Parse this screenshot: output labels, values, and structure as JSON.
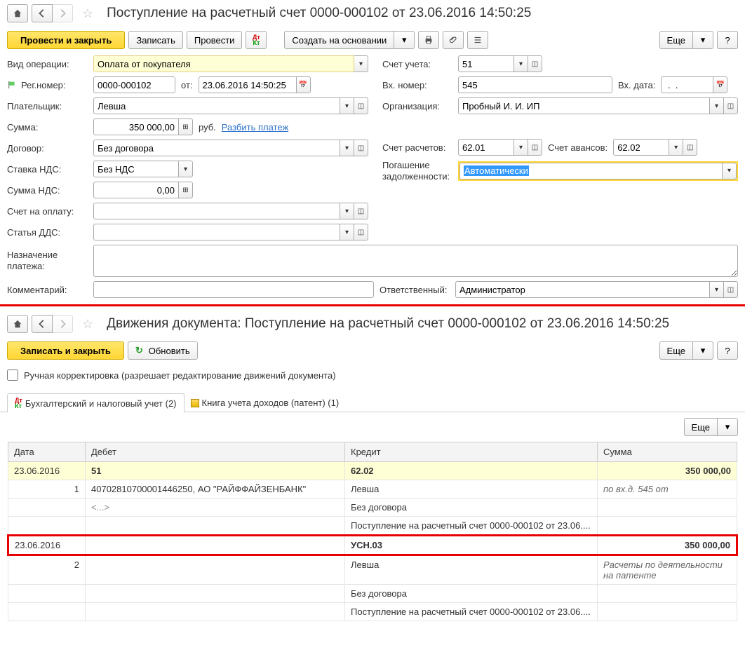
{
  "section1": {
    "title": "Поступление на расчетный счет 0000-000102 от 23.06.2016 14:50:25",
    "buttons": {
      "post_close": "Провести и закрыть",
      "save": "Записать",
      "post": "Провести",
      "create_based": "Создать на основании",
      "more": "Еще"
    },
    "labels": {
      "op_type": "Вид операции:",
      "reg_num": "Рег.номер:",
      "from": "от:",
      "payer": "Плательщик:",
      "sum": "Сумма:",
      "currency": "руб.",
      "split": "Разбить платеж",
      "contract": "Договор:",
      "vat_rate": "Ставка НДС:",
      "vat_sum": "Сумма НДС:",
      "invoice": "Счет на оплату:",
      "dds": "Статья ДДС:",
      "purpose": "Назначение платежа:",
      "comment": "Комментарий:",
      "account": "Счет учета:",
      "in_num": "Вх. номер:",
      "in_date": "Вх. дата:",
      "org": "Организация:",
      "settlement_acc": "Счет расчетов:",
      "advance_acc": "Счет авансов:",
      "debt_repay": "Погашение задолженности:",
      "responsible": "Ответственный:"
    },
    "values": {
      "op_type": "Оплата от покупателя",
      "reg_num": "0000-000102",
      "date": "23.06.2016 14:50:25",
      "payer": "Левша",
      "sum": "350 000,00",
      "contract": "Без договора",
      "vat_rate": "Без НДС",
      "vat_sum": "0,00",
      "invoice": "",
      "dds": "",
      "purpose": "",
      "comment": "",
      "account": "51",
      "in_num": "545",
      "in_date": " .  .",
      "org": "Пробный И. И. ИП",
      "settlement_acc": "62.01",
      "advance_acc": "62.02",
      "debt_repay": "Автоматически",
      "responsible": "Администратор"
    }
  },
  "section2": {
    "title": "Движения документа: Поступление на расчетный счет 0000-000102 от 23.06.2016 14:50:25",
    "buttons": {
      "save_close": "Записать и закрыть",
      "refresh": "Обновить",
      "more": "Еще"
    },
    "manual_correction": "Ручная корректировка (разрешает редактирование движений документа)",
    "tabs": {
      "accounting": "Бухгалтерский и налоговый учет (2)",
      "patent_book": "Книга учета доходов (патент) (1)"
    },
    "table": {
      "headers": {
        "date": "Дата",
        "debit": "Дебет",
        "credit": "Кредит",
        "sum": "Сумма"
      },
      "rows": [
        {
          "yellow": true,
          "date": "23.06.2016",
          "debit": "51",
          "credit": "62.02",
          "sum": "350 000,00"
        },
        {
          "seq": "1",
          "debit_detail": "40702810700001446250, АО \"РАЙФФАЙЗЕНБАНК\"",
          "credit_detail": "Левша",
          "note": "по вх.д. 545 от"
        },
        {
          "debit_sub": "<...>",
          "credit_detail": "Без договора"
        },
        {
          "credit_detail": "Поступление на расчетный счет 0000-000102 от 23.06...."
        },
        {
          "highlight": "red",
          "date": "23.06.2016",
          "credit": "УСН.03",
          "sum": "350 000,00"
        },
        {
          "seq": "2",
          "credit_detail": "Левша",
          "note": "Расчеты по деятельности на патенте"
        },
        {
          "credit_detail": "Без договора"
        },
        {
          "credit_detail": "Поступление на расчетный счет 0000-000102 от 23.06...."
        }
      ]
    }
  }
}
